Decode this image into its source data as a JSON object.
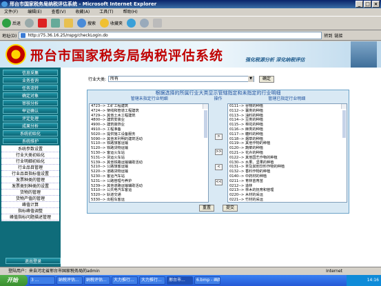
{
  "window": {
    "title": "邢台市国家税务局纳税评估系统 - Microsoft Internet Explorer"
  },
  "menu": [
    "文件(F)",
    "编辑(E)",
    "查看(V)",
    "收藏(A)",
    "工具(T)",
    "帮助(H)"
  ],
  "toolbar": {
    "back": "后退",
    "search": "搜索",
    "favorites": "收藏夹"
  },
  "address": {
    "label": "地址(D)",
    "url": "http://75.36.16.25/nspg/checkLogin.do",
    "go": "转到",
    "links": "链接"
  },
  "banner": {
    "title": "邢台市国家税务局纳税评估系统",
    "slogan": "强化税源分析  深化纳税评估"
  },
  "sidebar": {
    "items": [
      "信息采集",
      "业务查询",
      "任务流转",
      "确定对象",
      "审核分析",
      "举证确认",
      "评定处理",
      "成果分析",
      "系统初始化",
      "系统维护"
    ],
    "sub": [
      "系统参数设置",
      "行业大类初始化",
      "行业明细初始化",
      "行业品目管理",
      "行业品目指标值设置",
      "发票种类的管理",
      "发票类别种类的设置",
      "货物的管理",
      "货物产值的管理",
      "峰值计算",
      "指标峰值调整",
      "峰值指标问题描述管理"
    ],
    "logout": "退出登录"
  },
  "filter": {
    "label": "行业大类:",
    "value": "所有",
    "ok": "确定"
  },
  "panel": {
    "title": "根据选择的所属行业大类显示管辖指定和未指定的行业明细",
    "left_header": "管辖未指定行业明细",
    "op_header": "操作",
    "right_header": "管辖已指定行业明细",
    "left": [
      "4723--> 工矿工程建筑",
      "4724--> 架线和管道工程建筑",
      "4729--> 其他土木工程建筑",
      "4800--> 建筑安装业",
      "4900--> 建筑装饰业",
      "4910--> 工程准备",
      "5020--> 提供施工设备服务",
      "5090--> 其他未列明的建筑活动",
      "5110--> 铁路旅客运输",
      "5120--> 铁路货物运输",
      "5130--> 客运火车站",
      "5131--> 货运火车站",
      "5139--> 其他铁路运输辅助活动",
      "5210--> 公路旅客运输",
      "5220--> 道路货物运输",
      "5230--> 客运汽车站",
      "5231--> 公路管理与养护",
      "5239--> 其他道路运输辅助活动",
      "5310--> 公共电汽车客运",
      "5320--> 轨道交通",
      "5330--> 出租车客运",
      "5340--> 城市轮渡"
    ],
    "right": [
      "0111--> 谷物的种植",
      "0112--> 薯类的种植",
      "0113--> 油料的种植",
      "0114--> 豆类的种植",
      "0115--> 棉花的种植",
      "0116--> 麻类的种植",
      "0117--> 糖料的种植",
      "0118--> 烟草的种植",
      "0119--> 其他作物的种植",
      "0120--> 蔬菜的种植",
      "0121--> 花卉的种植",
      "0122--> 其他园艺作物的种植",
      "0130--> 水果、坚果的种植",
      "0131--> 茶及其他饮料作物的种植",
      "0132--> 香料作物的种植",
      "0140--> 中药材的种植",
      "0211--> 育林苗育苗",
      "0212--> 造林",
      "0213--> 林木的抚育和管理",
      "0220--> 木材的采运",
      "0221--> 竹材的采运"
    ],
    "move": [
      ">",
      ">>",
      "<",
      "<<"
    ],
    "reset": "重置",
    "submit": "提交"
  },
  "status": {
    "text": "登陆用户：来自河北省邢台市国家税务局的admin",
    "zone": "Internet"
  },
  "taskbar": {
    "start": "开始",
    "tasks": [
      "3 ...",
      "纳税评估...",
      "纳税评估...",
      "大力推行...",
      "大力推行...",
      "邢台市...",
      "6.bmp - 画图"
    ],
    "clock": "14:16"
  }
}
